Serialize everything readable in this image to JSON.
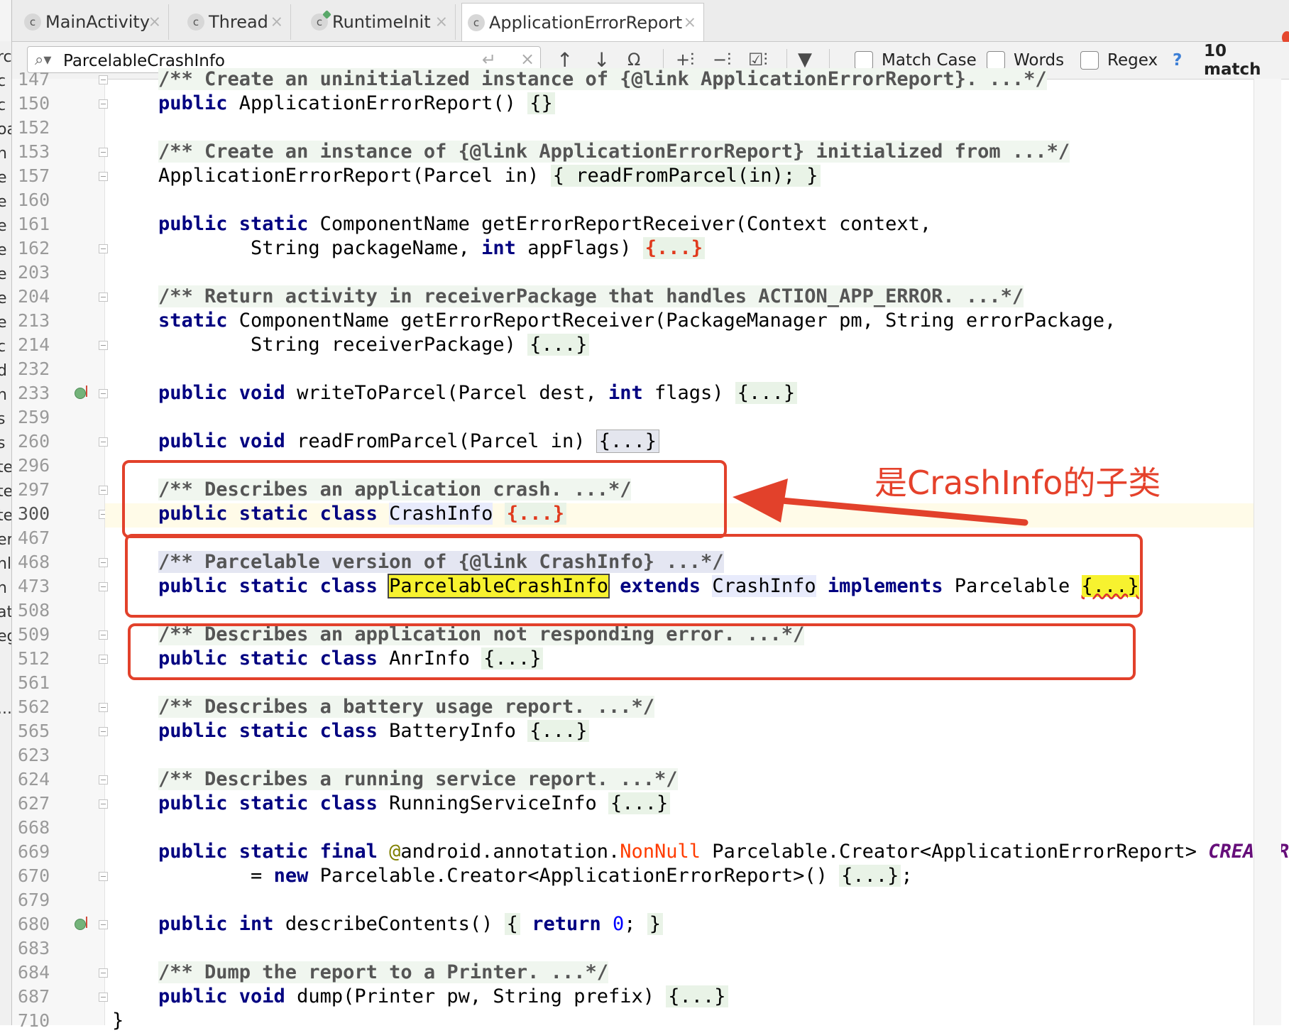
{
  "tabs": [
    {
      "label": "MainActivity",
      "icon": "class-icon"
    },
    {
      "label": "Thread",
      "icon": "class-icon"
    },
    {
      "label": "RuntimeInit",
      "icon": "class-run-icon"
    },
    {
      "label": "ApplicationErrorReport",
      "icon": "class-icon",
      "active": true
    }
  ],
  "search": {
    "query": "ParcelableCrashInfo",
    "match_case_label": "Match Case",
    "words_label": "Words",
    "regex_label": "Regex",
    "help_label": "?",
    "match_count": "10 match"
  },
  "left_strip_letters": [
    "rc",
    "c",
    "c",
    "oa",
    "n",
    "e",
    "e",
    "e",
    "e",
    "e",
    "e",
    "e",
    "c",
    "d",
    "h",
    "s",
    "s",
    "te",
    "te",
    "te",
    "er",
    "nl",
    "n",
    "at",
    "eg",
    "",
    "",
    "...",
    "",
    ""
  ],
  "line_numbers": [
    "147",
    "150",
    "152",
    "153",
    "157",
    "160",
    "161",
    "162",
    "203",
    "204",
    "213",
    "214",
    "232",
    "233",
    "259",
    "260",
    "296",
    "297",
    "300",
    "467",
    "468",
    "473",
    "508",
    "509",
    "512",
    "561",
    "562",
    "565",
    "623",
    "624",
    "627",
    "668",
    "669",
    "670",
    "679",
    "680",
    "683",
    "684",
    "687",
    "710"
  ],
  "code": {
    "l147": "/** Create an uninitialized instance of {@link ApplicationErrorReport}. ...*/",
    "l150_kw": "public",
    "l150": " ApplicationErrorReport() ",
    "l150_fold": "{}",
    "l153": "/** Create an instance of {@link ApplicationErrorReport} initialized from ...*/",
    "l157a": "ApplicationErrorReport(Parcel in) ",
    "l157b": "{ readFromParcel(in); }",
    "l161_kw": "public static",
    "l161": " ComponentName getErrorReportReceiver(Context context,",
    "l162a": "        String packageName, ",
    "l162_kw": "int",
    "l162b": " appFlags) ",
    "l162_fold": "{...}",
    "l204": "/** Return activity in receiverPackage that handles ACTION_APP_ERROR. ...*/",
    "l213_kw": "static",
    "l213": " ComponentName getErrorReportReceiver(PackageManager pm, String errorPackage,",
    "l214": "        String receiverPackage) ",
    "l214_fold": "{...}",
    "l233_kw1": "public void",
    "l233a": " writeToParcel(Parcel dest, ",
    "l233_kw2": "int",
    "l233b": " flags) ",
    "l233_fold": "{...}",
    "l260_kw": "public void",
    "l260": " readFromParcel(Parcel in) ",
    "l260_fold": "{...}",
    "l297": "/** Describes an application crash. ...*/",
    "l300_kw": "public static class",
    "l300_sp": " ",
    "l300_name": "CrashInfo",
    "l300_fold": "{...}",
    "l468": "/** Parcelable version of {@link CrashInfo} ...*/",
    "l473_kw": "public static class",
    "l473_name": "ParcelableCrashInfo",
    "l473_ext": "extends",
    "l473_base": "CrashInfo",
    "l473_impl": "implements",
    "l473_iface": " Parcelable ",
    "l473_fold": "{...}",
    "l509": "/** Describes an application not responding error. ...*/",
    "l512_kw": "public static class",
    "l512": " AnrInfo ",
    "l512_fold": "{...}",
    "l562": "/** Describes a battery usage report. ...*/",
    "l565_kw": "public static class",
    "l565": " BatteryInfo ",
    "l565_fold": "{...}",
    "l624": "/** Describes a running service report. ...*/",
    "l627_kw": "public static class",
    "l627": " RunningServiceInfo ",
    "l627_fold": "{...}",
    "l669_kw": "public static final",
    "l669_ann1": " @",
    "l669_ann2": "android.annotation.",
    "l669_nn": "NonNull",
    "l669": " Parcelable.Creator<ApplicationErrorReport> ",
    "l669_creator": "CREATOR",
    "l670a": "        = ",
    "l670_kw": "new",
    "l670b": " Parcelable.Creator<ApplicationErrorReport>() ",
    "l670_fold": "{...}",
    "l670c": ";",
    "l680_kw": "public int",
    "l680a": " describeContents() ",
    "l680_ob": "{",
    "l680_ret": " return ",
    "l680_num": "0",
    "l680_semi": "; ",
    "l680_cb": "}",
    "l684": "/** Dump the report to a Printer. ...*/",
    "l687_kw": "public void",
    "l687": " dump(Printer pw, String prefix) ",
    "l687_fold": "{...}",
    "l710": "}"
  },
  "annotation": {
    "text": "是CrashInfo的子类",
    "color": "#e5412b"
  },
  "colors": {
    "keyword": "#000080",
    "comment": "#555555",
    "search_highlight": "#f7f22f",
    "annotation_red": "#e2412b"
  }
}
